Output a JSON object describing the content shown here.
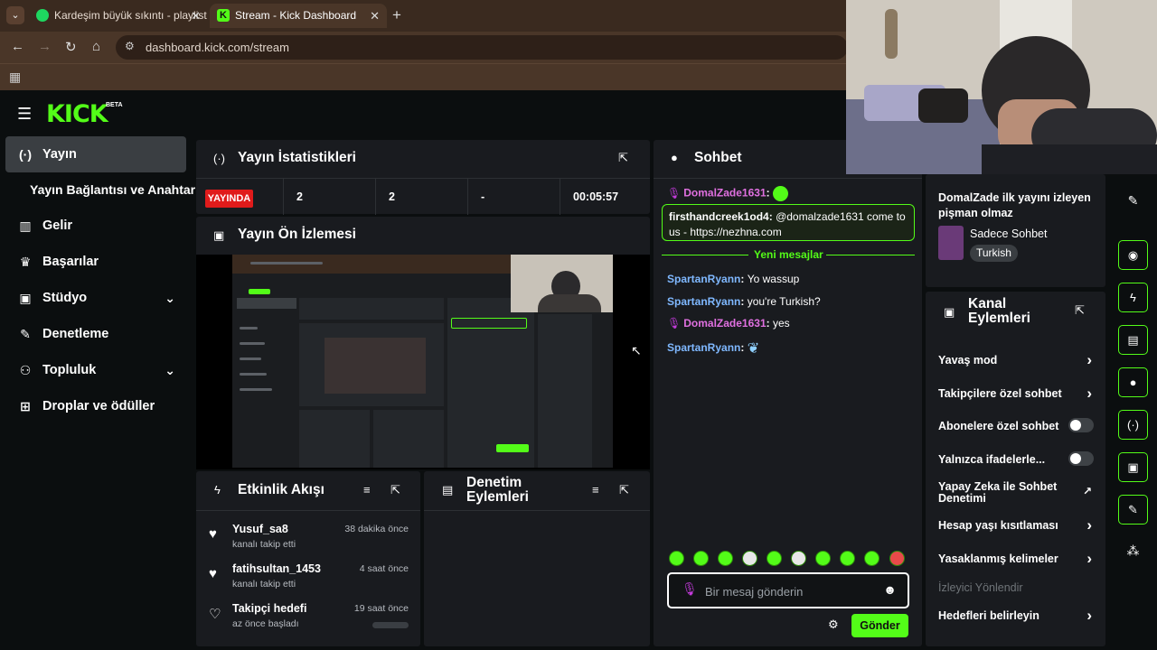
{
  "browser": {
    "tabs": [
      {
        "title": "Kardeşim büyük sıkıntı - playlist",
        "icon": "spotify-icon"
      },
      {
        "title": "Stream - Kick Dashboard",
        "icon": "kick-icon"
      }
    ],
    "url": "dashboard.kick.com/stream"
  },
  "brand": {
    "logo": "KICK",
    "beta": "BETA",
    "accent": "#53fc18"
  },
  "sidebar": {
    "items": [
      {
        "label": "Yayın",
        "icon": "broadcast-icon",
        "active": true
      },
      {
        "label": "Gelir",
        "icon": "chart-icon"
      },
      {
        "label": "Başarılar",
        "icon": "trophy-icon"
      },
      {
        "label": "Stüdyo",
        "icon": "video-icon"
      },
      {
        "label": "Denetleme",
        "icon": "wrench-icon"
      },
      {
        "label": "Topluluk",
        "icon": "users-icon"
      },
      {
        "label": "Droplar ve ödüller",
        "icon": "gift-icon"
      }
    ],
    "sub_label": "Yayın Bağlantısı ve Anahtarı"
  },
  "stats": {
    "title": "Yayın İstatistikleri",
    "status": "YAYINDA",
    "viewers": "2",
    "followers": "2",
    "other": "-",
    "uptime": "00:05:57",
    "status_color": "#e01b1b"
  },
  "preview": {
    "title": "Yayın Ön İzlemesi"
  },
  "activity": {
    "title": "Etkinlik Akışı",
    "items": [
      {
        "name": "Yusuf_sa8",
        "sub": "kanalı takip etti",
        "time": "38 dakika önce"
      },
      {
        "name": "fatihsultan_1453",
        "sub": "kanalı takip etti",
        "time": "4 saat önce"
      },
      {
        "name": "Takipçi hedefi",
        "sub": "az önce başladı",
        "time": "19 saat önce",
        "progress": 0.0
      }
    ]
  },
  "moderation": {
    "title": "Denetim Eylemleri"
  },
  "chat": {
    "title": "Sohbet",
    "messages": [
      {
        "user": "DomalZade1631",
        "text": ""
      },
      {
        "user": "firsthandcreek1od4",
        "text": "@domalzade1631 come to us - https://nezhna.com"
      },
      {
        "user": "SpartanRyann",
        "text": "Yo wassup"
      },
      {
        "user": "SpartanRyann",
        "text": "you're Turkish?"
      },
      {
        "user": "DomalZade1631",
        "text": "yes"
      },
      {
        "user": "SpartanRyann",
        "text": ""
      }
    ],
    "new_messages": "Yeni mesajlar",
    "placeholder": "Bir mesaj gönderin",
    "send": "Gönder"
  },
  "channel": {
    "stream_title": "DomalZade ilk yayını izleyen pişman olmaz",
    "category": "Sadece Sohbet",
    "tag": "Turkish"
  },
  "actions": {
    "title": "Kanal Eylemleri",
    "items": [
      {
        "label": "Yavaş mod",
        "control": "arrow"
      },
      {
        "label": "Takipçilere özel sohbet",
        "control": "arrow"
      },
      {
        "label": "Abonelere özel sohbet",
        "control": "toggle"
      },
      {
        "label": "Yalnızca ifadelerle...",
        "control": "toggle"
      },
      {
        "label": "Yapay Zeka ile Sohbet Denetimi",
        "control": "external"
      },
      {
        "label": "Hesap yaşı kısıtlaması",
        "control": "arrow"
      },
      {
        "label": "Yasaklanmış kelimeler",
        "control": "arrow"
      },
      {
        "label": "İzleyici Yönlendir",
        "control": "none"
      },
      {
        "label": "Hedefleri belirleyin",
        "control": "arrow"
      }
    ]
  }
}
